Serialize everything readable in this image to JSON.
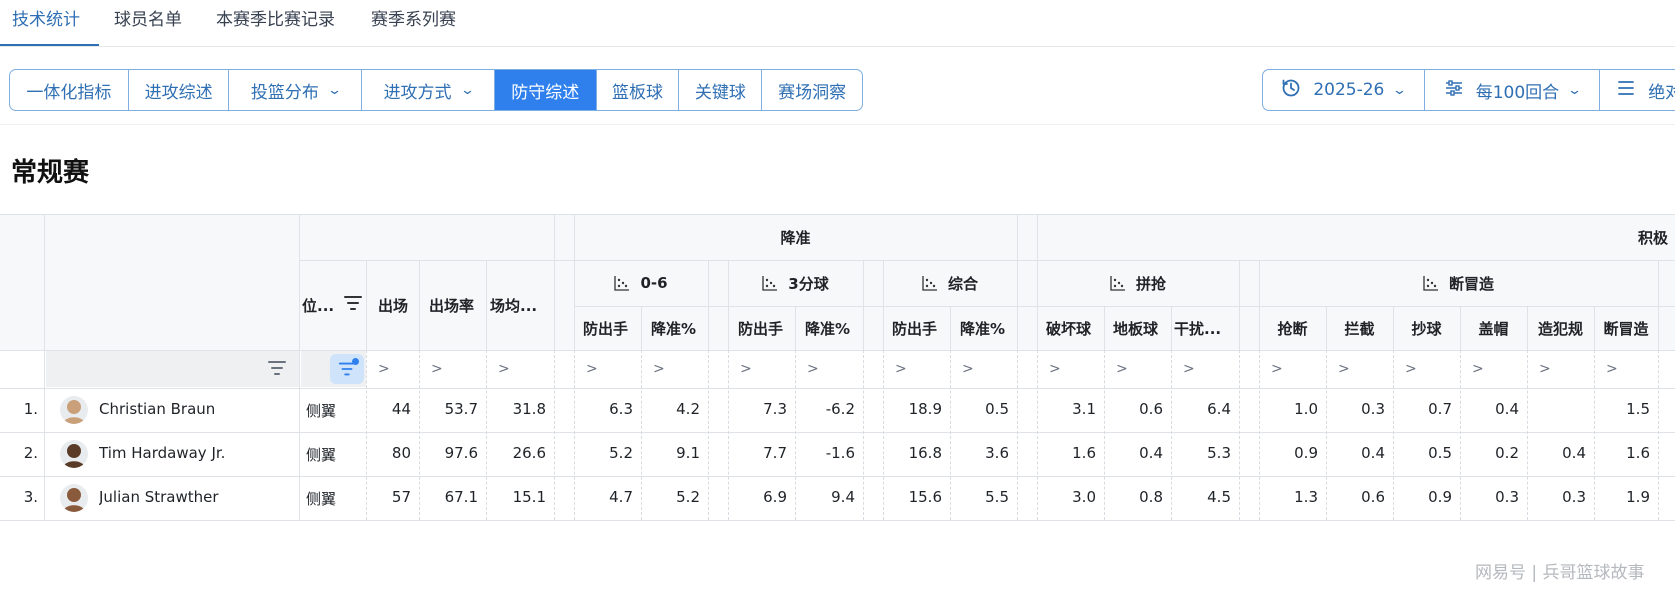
{
  "top_tabs": [
    "技术统计",
    "球员名单",
    "本赛季比赛记录",
    "赛季系列赛"
  ],
  "segments": [
    "一体化指标",
    "进攻综述",
    "投篮分布",
    "进攻方式",
    "防守综述",
    "篮板球",
    "关键球",
    "赛场洞察"
  ],
  "right_controls": {
    "season": "2025-26",
    "per_mode": "每100回合",
    "mode_partial": "绝对"
  },
  "colors": {
    "accent": "#2f6fb3",
    "active_bg": "#2f80ed",
    "border": "#7faee0"
  },
  "icons": {
    "season": "history-icon",
    "per_mode": "sliders-icon",
    "mode": "list-icon",
    "filter": "filter-icon",
    "group": "scatter-icon"
  },
  "section_title": "常规赛",
  "table": {
    "group_top": {
      "defense": "降准",
      "active": "积极"
    },
    "groups": {
      "g06": "0-6",
      "g3pt": "3分球",
      "gall": "综合",
      "scramble": "拼抢",
      "steal": "断冒造"
    },
    "headers": {
      "pos": "位...",
      "gp": "出场",
      "gp_pct": "出场率",
      "min": "场均...",
      "d06_fga": "防出手",
      "d06_pct": "降准%",
      "d3_fga": "防出手",
      "d3_pct": "降准%",
      "dall_fga": "防出手",
      "dall_pct": "降准%",
      "deflect": "破坏球",
      "loose": "地板球",
      "contest": "干扰...",
      "stl": "抢断",
      "blk": "拦截",
      "chg": "抄球",
      "cap": "盖帽",
      "foul": "造犯规",
      "dmz": "断冒造"
    },
    "filter_symbol": ">",
    "rows": [
      {
        "rank": "1.",
        "name": "Christian Braun",
        "pos": "侧翼",
        "gp": "44",
        "gp_pct": "53.7",
        "min": "31.8",
        "d06_fga": "6.3",
        "d06_pct": "4.2",
        "d3_fga": "7.3",
        "d3_pct": "-6.2",
        "dall_fga": "18.9",
        "dall_pct": "0.5",
        "deflect": "3.1",
        "loose": "0.6",
        "contest": "6.4",
        "stl": "1.0",
        "blk": "0.3",
        "chg": "0.7",
        "cap": "0.4",
        "foul": "",
        "dmz": "1.5"
      },
      {
        "rank": "2.",
        "name": "Tim Hardaway Jr.",
        "pos": "侧翼",
        "gp": "80",
        "gp_pct": "97.6",
        "min": "26.6",
        "d06_fga": "5.2",
        "d06_pct": "9.1",
        "d3_fga": "7.7",
        "d3_pct": "-1.6",
        "dall_fga": "16.8",
        "dall_pct": "3.6",
        "deflect": "1.6",
        "loose": "0.4",
        "contest": "5.3",
        "stl": "0.9",
        "blk": "0.4",
        "chg": "0.5",
        "cap": "0.2",
        "foul": "0.4",
        "dmz": "1.6"
      },
      {
        "rank": "3.",
        "name": "Julian Strawther",
        "pos": "侧翼",
        "gp": "57",
        "gp_pct": "67.1",
        "min": "15.1",
        "d06_fga": "4.7",
        "d06_pct": "5.2",
        "d3_fga": "6.9",
        "d3_pct": "9.4",
        "dall_fga": "15.6",
        "dall_pct": "5.5",
        "deflect": "3.0",
        "loose": "0.8",
        "contest": "4.5",
        "stl": "1.3",
        "blk": "0.6",
        "chg": "0.9",
        "cap": "0.3",
        "foul": "0.3",
        "dmz": "1.9"
      }
    ]
  },
  "watermark": "网易号 | 兵哥篮球故事"
}
